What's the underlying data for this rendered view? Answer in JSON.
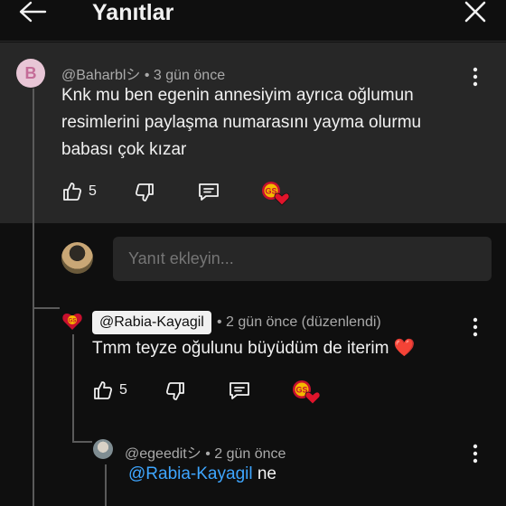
{
  "header": {
    "title": "Yanıtlar"
  },
  "parent_comment": {
    "avatar_letter": "B",
    "author": "@Baharblシ",
    "time": "3 gün önce",
    "text_lines": [
      "Knk mu ben egenin annesiyim ayrıca oğlumun",
      "resimlerini paylaşma numarasını yayma olurmu",
      "babası çok kızar"
    ],
    "likes": "5"
  },
  "reply_box": {
    "placeholder": "Yanıt ekleyin..."
  },
  "reply_1": {
    "author": "@Rabia-Kayagil",
    "time": "2 gün önce (düzenlendi)",
    "text": "Tmm teyze oğulunu büyüdüm de iterim",
    "heart": "❤️",
    "likes": "5"
  },
  "reply_2": {
    "author": "@egeeditシ",
    "time": "2 gün önce",
    "mention": "@Rabia-Kayagil",
    "text": "ne"
  },
  "colors": {
    "background": "#0f0f0f",
    "highlight": "#272727",
    "link": "#3ea6ff",
    "heart": "#e0142b"
  },
  "icons": [
    "back-arrow-icon",
    "close-icon",
    "more-vert-icon",
    "thumb-up-icon",
    "thumb-down-icon",
    "reply-comment-icon",
    "gs-heart-icon"
  ]
}
